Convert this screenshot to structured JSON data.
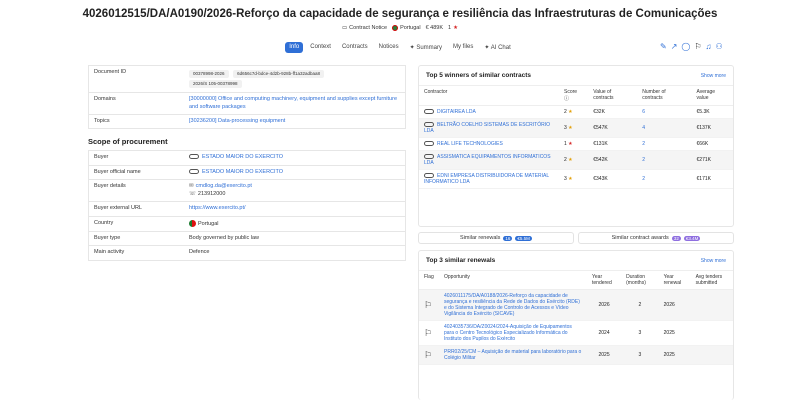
{
  "title": "4026012515/DA/A0190/2026-Reforço da capacidade de segurança e resiliência das Infraestruturas de Comunicações",
  "meta": {
    "notice": "Contract Notice",
    "country": "Portugal",
    "value": "€ 489K",
    "rank": "1"
  },
  "tabs": [
    "Info",
    "Context",
    "Contracts",
    "Notices",
    "Summary",
    "My files",
    "AI Chat"
  ],
  "tool_icons": [
    "edit-icon",
    "share-icon",
    "chat-icon",
    "flag-icon",
    "bell-icon",
    "user-plus-icon"
  ],
  "details": {
    "document_id_label": "Document ID",
    "document_ids": [
      "00378998-2026",
      "6d656c7d-bdce-4d2b-928b-ff1a32adbaa8",
      "2026/S 105-00378998"
    ],
    "domains_label": "Domains",
    "domains": "[30000000] Office and computing machinery, equipment and supplies except furniture and software packages",
    "topics_label": "Topics",
    "topics": "[30236200] Data-processing equipment"
  },
  "scope": {
    "title": "Scope of procurement",
    "buyer_label": "Buyer",
    "buyer": "ESTADO MAIOR DO EXERCITO",
    "official_label": "Buyer official name",
    "official": "ESTADO MAIOR DO EXERCITO",
    "details_label": "Buyer details",
    "email": "cmdlog.da@exercito.pt",
    "phone": "213912000",
    "url_label": "Buyer external URL",
    "url": "https://www.exercito.pt/",
    "country_label": "Country",
    "country": "Portugal",
    "type_label": "Buyer type",
    "type": "Body governed by public law",
    "activity_label": "Main activity",
    "activity": "Defence"
  },
  "winners": {
    "title": "Top 5 winners of similar contracts",
    "more": "Show more",
    "headers": [
      "Contractor",
      "Score",
      "Value of contracts",
      "Number of contracts",
      "Average value"
    ],
    "rows": [
      {
        "name": "DIGITAIREA LDA",
        "score": "2",
        "value": "€32K",
        "count": "6",
        "avg": "€5.3K"
      },
      {
        "name": "BELTRÃO COELHO SISTEMAS DE ESCRITÓRIO LDA",
        "score": "3",
        "value": "€547K",
        "count": "4",
        "avg": "€137K"
      },
      {
        "name": "REAL LIFE TECHNOLOGIES",
        "score": "1",
        "value": "€131K",
        "count": "2",
        "avg": "€66K"
      },
      {
        "name": "ASSISMATICA EQUIPAMENTOS INFORMATICOS LDA",
        "score": "2",
        "value": "€542K",
        "count": "2",
        "avg": "€271K"
      },
      {
        "name": "EDNI EMPRESA DISTRIBUIDORA DE MATERIAL INFORMATICO LDA",
        "score": "3",
        "value": "€343K",
        "count": "2",
        "avg": "€171K"
      }
    ]
  },
  "buttons": {
    "renewals": "Similar renewals",
    "renewals_count": "16",
    "renewals_value": "€5.5M",
    "awards": "Similar contract awards",
    "awards_count": "32",
    "awards_value": "€3.4M"
  },
  "renewals": {
    "title": "Top 3 similar renewals",
    "more": "Show more",
    "headers": [
      "Flag",
      "Opportunity",
      "Year tendered",
      "Duration (months)",
      "Year renewal",
      "Avg tenders submitted"
    ],
    "rows": [
      {
        "opp": "4026011175/DA/A0188/2026-Reforço da capacidade de segurança e resiliência da Rede de Dados do Exército (RDE) e do Sistema Integrado de Controlo de Acessos e Vídeo Vigilância do Exército (SICAVE)",
        "year": "2026",
        "dur": "2",
        "renew": "2026"
      },
      {
        "opp": "4024035736/DA/Z0024/2024-Aquisição de Equipamentos para o Centro Tecnológico Especializado Informática do Instituto dos Pupilos do Exército",
        "year": "2024",
        "dur": "3",
        "renew": "2025"
      },
      {
        "opp": "PRR02/25/CM – Aquisição de material para laboratório para o Colégio Militar",
        "year": "2025",
        "dur": "3",
        "renew": "2025"
      }
    ]
  }
}
